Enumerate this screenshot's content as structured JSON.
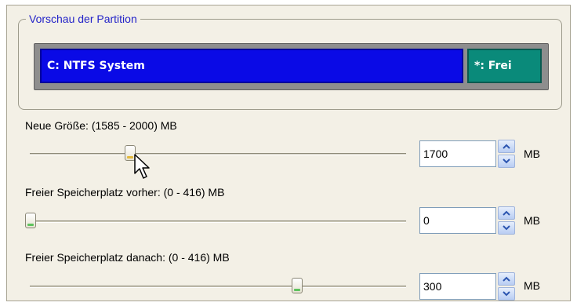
{
  "preview": {
    "title": "Vorschau der Partition",
    "partitions": [
      {
        "label": "C: NTFS System",
        "color": "#0a0ae6"
      },
      {
        "label": "*: Frei",
        "color": "#0a8a7a"
      }
    ]
  },
  "rows": [
    {
      "label": "Neue Größe: (1585 - 2000) MB",
      "value": "1700",
      "unit": "MB",
      "slider_fraction": 0.27
    },
    {
      "label": "Freier Speicherplatz vorher: (0 - 416) MB",
      "value": "0",
      "unit": "MB",
      "slider_fraction": 0.0
    },
    {
      "label": "Freier Speicherplatz danach: (0 - 416) MB",
      "value": "300",
      "unit": "MB",
      "slider_fraction": 0.72
    }
  ],
  "icons": {
    "spin_up": "chevron-up-icon",
    "spin_down": "chevron-down-icon",
    "cursor": "mouse-pointer-icon"
  },
  "colors": {
    "group_title": "#2323c8",
    "background": "#f3f0e6"
  }
}
